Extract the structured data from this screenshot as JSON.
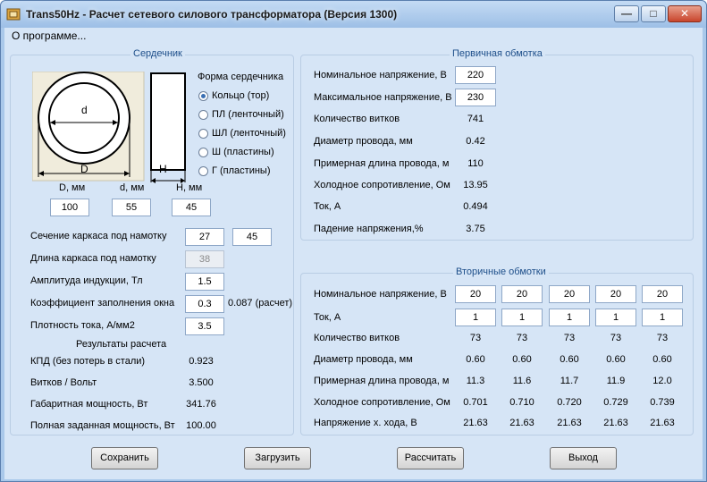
{
  "window": {
    "title": "Trans50Hz - Расчет сетевого силового трансформатора (Версия 1300)",
    "icons": [
      "app-icon",
      "minimize-icon",
      "maximize-icon",
      "close-icon"
    ]
  },
  "menu": {
    "about": "О программе..."
  },
  "core": {
    "title": "Сердечник",
    "shape_title": "Форма сердечника",
    "shape_options": [
      "Кольцо  (тор)",
      "ПЛ  (ленточный)",
      "ШЛ  (ленточный)",
      "Ш  (пластины)",
      "Г (пластины)"
    ],
    "selected_shape": "Кольцо  (тор)",
    "diagram_labels": {
      "d": "d",
      "D": "D",
      "H": "H"
    },
    "dim_labels": {
      "D": "D, мм",
      "d": "d, мм",
      "H": "H, мм"
    },
    "dims": {
      "D": "100",
      "d": "55",
      "H": "45"
    }
  },
  "params": {
    "section_label": "Сечение каркаса под намотку",
    "section_1": "27",
    "section_2": "45",
    "length_label": "Длина каркаса под намотку",
    "length_value": "38",
    "induction_label": "Амплитуда индукции, Тл",
    "induction_value": "1.5",
    "fill_label": "Коэффициент заполнения окна",
    "fill_value": "0.3",
    "fill_calc": "0.087 (расчет)",
    "density_label": "Плотность тока, А/мм2",
    "density_value": "3.5"
  },
  "results": {
    "title": "Результаты расчета",
    "rows": [
      {
        "label": "КПД (без потерь в стали)",
        "value": "0.923"
      },
      {
        "label": "Витков / Вольт",
        "value": "3.500"
      },
      {
        "label": "Габаритная мощность, Вт",
        "value": "341.76"
      },
      {
        "label": "Полная заданная мощность, Вт",
        "value": "100.00"
      }
    ]
  },
  "primary": {
    "title": "Первичная обмотка",
    "rated_voltage_label": "Номинальное напряжение, В",
    "rated_voltage": "220",
    "max_voltage_label": "Максимальное напряжение, В",
    "max_voltage": "230",
    "rows": [
      {
        "label": "Количество витков",
        "value": "741"
      },
      {
        "label": "Диаметр провода, мм",
        "value": "0.42"
      },
      {
        "label": "Примерная длина провода, м",
        "value": "110"
      },
      {
        "label": "Холодное сопротивление, Ом",
        "value": "13.95"
      },
      {
        "label": "Ток, А",
        "value": "0.494"
      },
      {
        "label": "Падение напряжения,%",
        "value": "3.75"
      }
    ]
  },
  "secondary": {
    "title": "Вторичные обмотки",
    "voltage_label": "Номинальное напряжение, В",
    "voltages": [
      "20",
      "20",
      "20",
      "20",
      "20"
    ],
    "current_label": "Ток, А",
    "currents": [
      "1",
      "1",
      "1",
      "1",
      "1"
    ],
    "rows": [
      {
        "label": "Количество витков",
        "values": [
          "73",
          "73",
          "73",
          "73",
          "73"
        ]
      },
      {
        "label": "Диаметр провода, мм",
        "values": [
          "0.60",
          "0.60",
          "0.60",
          "0.60",
          "0.60"
        ]
      },
      {
        "label": "Примерная длина провода, м",
        "values": [
          "11.3",
          "11.6",
          "11.7",
          "11.9",
          "12.0"
        ]
      },
      {
        "label": "Холодное сопротивление, Ом",
        "values": [
          "0.701",
          "0.710",
          "0.720",
          "0.729",
          "0.739"
        ]
      },
      {
        "label": "Напряжение х. хода, В",
        "values": [
          "21.63",
          "21.63",
          "21.63",
          "21.63",
          "21.63"
        ]
      }
    ]
  },
  "buttons": {
    "save": "Сохранить",
    "load": "Загрузить",
    "calc": "Рассчитать",
    "exit": "Выход"
  }
}
